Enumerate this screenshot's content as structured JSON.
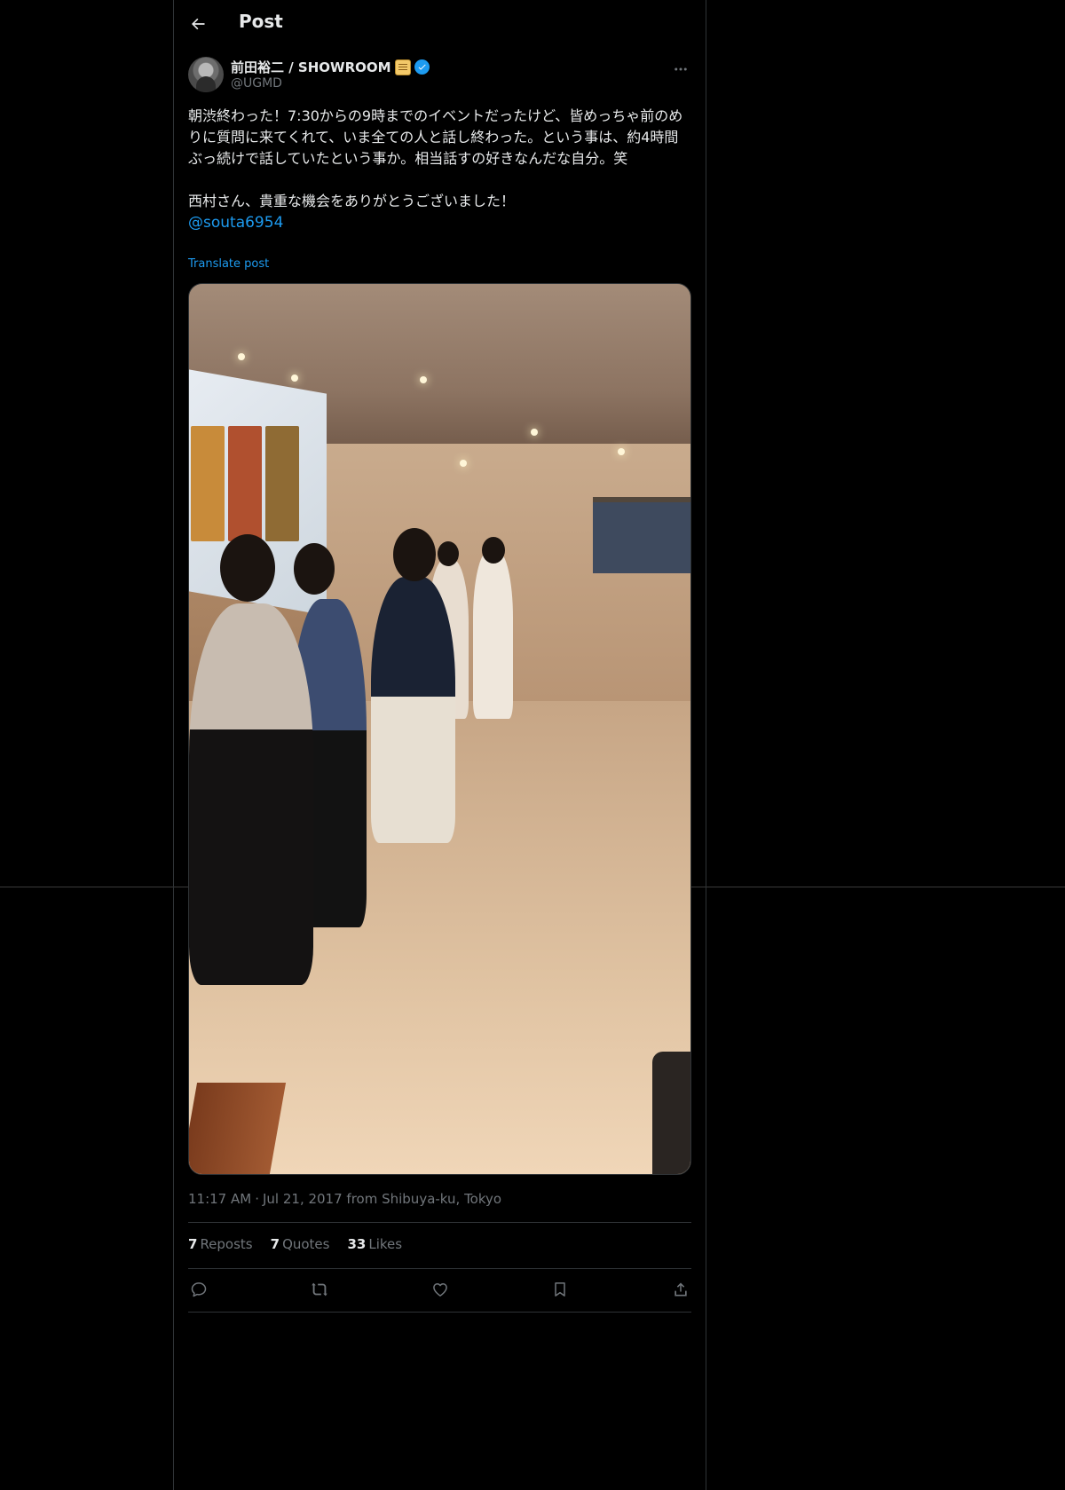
{
  "header": {
    "title": "Post"
  },
  "author": {
    "display_name": "前田裕二 / SHOWROOM",
    "handle": "@UGMD"
  },
  "post": {
    "paragraph1": "朝渋終わった！7:30からの9時までのイベントだったけど、皆めっちゃ前のめりに質問に来てくれて、いま全ての人と話し終わった。という事は、約4時間ぶっ続けで話していたという事か。相当話すの好きなんだな自分。笑",
    "paragraph2": "西村さん、貴重な機会をありがとうございました！",
    "mention": "@souta6954",
    "translate_label": "Translate post"
  },
  "meta": {
    "time": "11:17 AM",
    "date_location": "Jul 21, 2017 from Shibuya-ku, Tokyo"
  },
  "stats": {
    "reposts_count": "7",
    "reposts_label": "Reposts",
    "quotes_count": "7",
    "quotes_label": "Quotes",
    "likes_count": "33",
    "likes_label": "Likes"
  },
  "icons": {
    "back": "arrow-left-icon",
    "more": "more-horizontal-icon",
    "verified": "verified-badge-icon",
    "reply": "reply-icon",
    "repost": "repost-icon",
    "like": "heart-icon",
    "bookmark": "bookmark-icon",
    "share": "share-icon"
  },
  "colors": {
    "background": "#000000",
    "text": "#e7e9ea",
    "secondary": "#71767b",
    "accent": "#1d9bf0",
    "divider": "#2f3336"
  }
}
